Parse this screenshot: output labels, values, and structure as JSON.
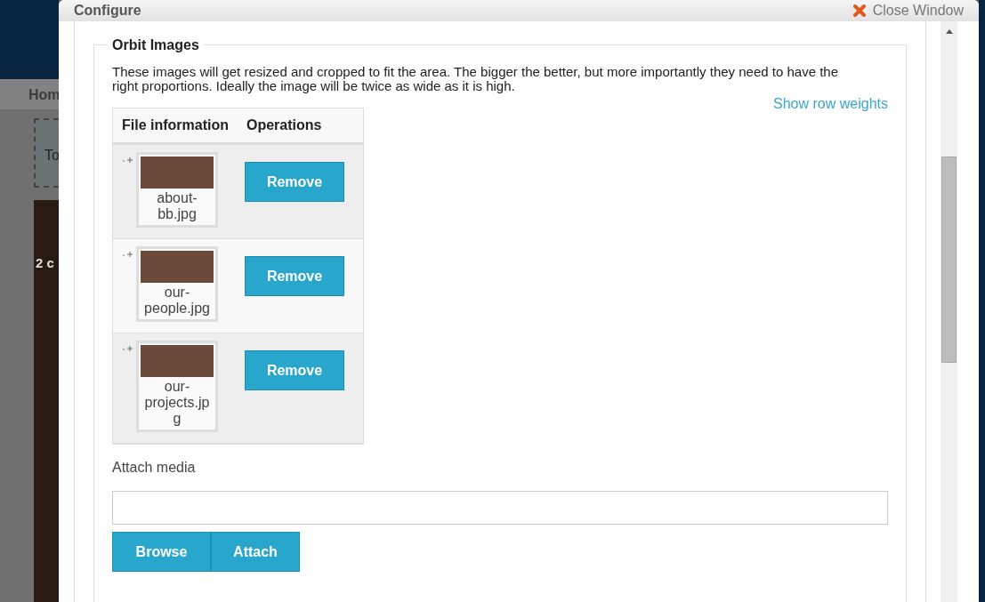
{
  "background": {
    "nav_item": "Hom",
    "box_text": "To",
    "counter": "2 c"
  },
  "window": {
    "title": "Configure",
    "close_label": "Close Window"
  },
  "fieldset": {
    "legend": "Orbit Images",
    "description": "These images will get resized and cropped to fit the area. The bigger the better, but more importantly they need to have the right proportions. Ideally the image will be twice as wide as it is high.",
    "row_weights_link": "Show row weights",
    "table": {
      "columns": [
        "File information",
        "Operations"
      ],
      "rows": [
        {
          "filename": "about-bb.jpg",
          "action": "Remove"
        },
        {
          "filename": "our-people.jpg",
          "action": "Remove"
        },
        {
          "filename": "our-projects.jpg",
          "action": "Remove"
        }
      ]
    }
  },
  "attach": {
    "label": "Attach media",
    "buttons": [
      "Browse",
      "Attach"
    ]
  }
}
